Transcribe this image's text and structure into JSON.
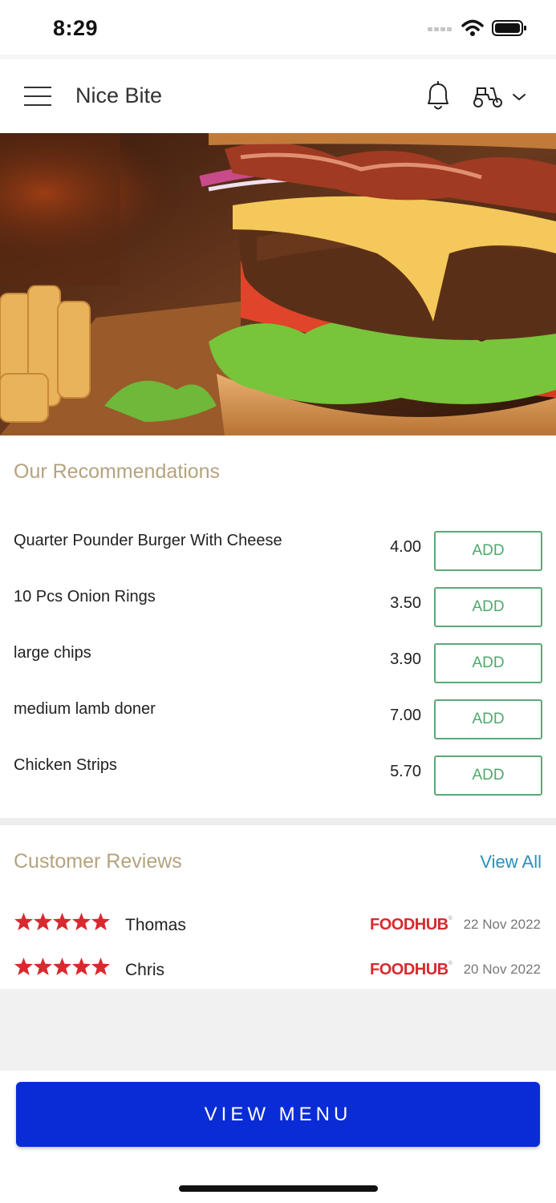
{
  "status_bar": {
    "time": "8:29"
  },
  "header": {
    "title": "Nice Bite"
  },
  "recommendations": {
    "title": "Our Recommendations",
    "items": [
      {
        "name": "Quarter Pounder Burger With Cheese",
        "price": "4.00",
        "button": "ADD"
      },
      {
        "name": "10 Pcs Onion Rings",
        "price": "3.50",
        "button": "ADD"
      },
      {
        "name": "large chips",
        "price": "3.90",
        "button": "ADD"
      },
      {
        "name": "medium lamb doner",
        "price": "7.00",
        "button": "ADD"
      },
      {
        "name": "Chicken Strips",
        "price": "5.70",
        "button": "ADD"
      }
    ]
  },
  "reviews": {
    "title": "Customer Reviews",
    "view_all": "View All",
    "items": [
      {
        "rating": 5,
        "name": "Thomas",
        "source": "FOODHUB",
        "date": "22 Nov 2022"
      },
      {
        "rating": 5,
        "name": "Chris",
        "source": "FOODHUB",
        "date": "20 Nov 2022"
      }
    ]
  },
  "footer": {
    "view_menu": "VIEW MENU"
  },
  "colors": {
    "accent_title": "#b4a37e",
    "add_green": "#4caa6a",
    "link_blue": "#2a91b8",
    "button_blue": "#0a2cd6",
    "star_red": "#d8292f"
  },
  "icons": [
    "menu-icon",
    "bell-icon",
    "scooter-icon",
    "chevron-down-icon",
    "star-icon",
    "signal-icon",
    "wifi-icon",
    "battery-icon"
  ]
}
